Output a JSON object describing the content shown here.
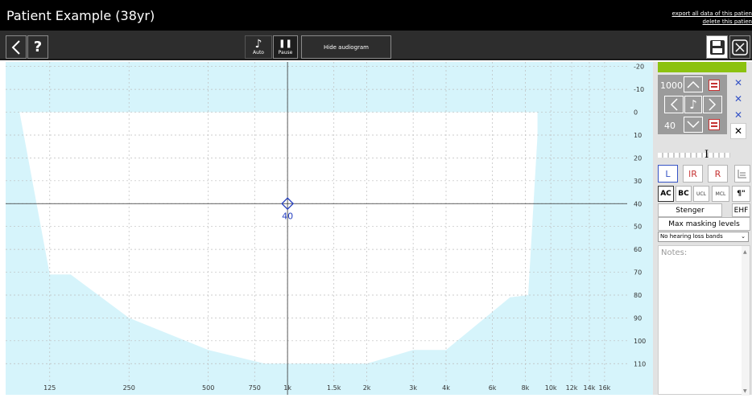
{
  "window": {
    "title": "Patient Example (38yr)",
    "export_link": "export all data of this patien",
    "delete_link": "delete this patien"
  },
  "toolbar": {
    "back_icon": "chevron-left-icon",
    "help_label": "?",
    "auto_label": "Auto",
    "pause_label": "Pause",
    "hide_audiogram_label": "Hide audiogram",
    "save_icon": "floppy-disk-icon",
    "close_icon": "close-icon"
  },
  "controls": {
    "frequency_value": "1000",
    "level_value": "40",
    "ear_left": "L",
    "ear_both": "lR",
    "ear_right": "R",
    "ac_label": "AC",
    "bc_label": "BC",
    "ucl_label": "UCL",
    "mcl_label": "MCL",
    "stenger_label": "Stenger",
    "ehf_label": "EHF",
    "max_masking_label": "Max masking levels",
    "band_select_value": "No hearing loss bands",
    "notes_placeholder": "Notes:",
    "accent_color": "#8cc210"
  },
  "chart_data": {
    "type": "scatter",
    "title": "",
    "xlabel": "",
    "ylabel": "",
    "x_scale": "log",
    "x_ticks": [
      "125",
      "250",
      "500",
      "750",
      "1k",
      "1.5k",
      "2k",
      "3k",
      "4k",
      "6k",
      "8k",
      "10k",
      "12k",
      "14k",
      "16k"
    ],
    "x_tick_values": [
      125,
      250,
      500,
      750,
      1000,
      1500,
      2000,
      3000,
      4000,
      6000,
      8000,
      10000,
      12000,
      14000,
      16000
    ],
    "xlim": [
      85,
      19500
    ],
    "y_ticks": [
      "-20",
      "-10",
      "0",
      "10",
      "20",
      "30",
      "40",
      "50",
      "60",
      "70",
      "80",
      "90",
      "100",
      "110"
    ],
    "y_tick_values": [
      -20,
      -10,
      0,
      10,
      20,
      30,
      40,
      50,
      60,
      70,
      80,
      90,
      100,
      110
    ],
    "ylim": [
      -22,
      118
    ],
    "y_inverted": true,
    "grid": true,
    "normal_hearing_region": [
      {
        "x": 96,
        "y": 0
      },
      {
        "x": 8900,
        "y": 0
      },
      {
        "x": 8900,
        "y": 10
      },
      {
        "x": 8200,
        "y": 80
      },
      {
        "x": 7000,
        "y": 81
      },
      {
        "x": 4000,
        "y": 104
      },
      {
        "x": 3000,
        "y": 104
      },
      {
        "x": 2000,
        "y": 110
      },
      {
        "x": 820,
        "y": 110
      },
      {
        "x": 500,
        "y": 104
      },
      {
        "x": 250,
        "y": 90
      },
      {
        "x": 150,
        "y": 71
      },
      {
        "x": 125,
        "y": 71
      },
      {
        "x": 96,
        "y": 0
      }
    ],
    "cursor": {
      "frequency": 1000,
      "level": 40
    },
    "points": [
      {
        "x": 1000,
        "y": 40,
        "label": "40",
        "marker": "diamond",
        "color": "#2640c0"
      }
    ],
    "colors": {
      "background": "#d6f4fb",
      "region": "#ffffff",
      "marker": "#2640c0"
    }
  }
}
